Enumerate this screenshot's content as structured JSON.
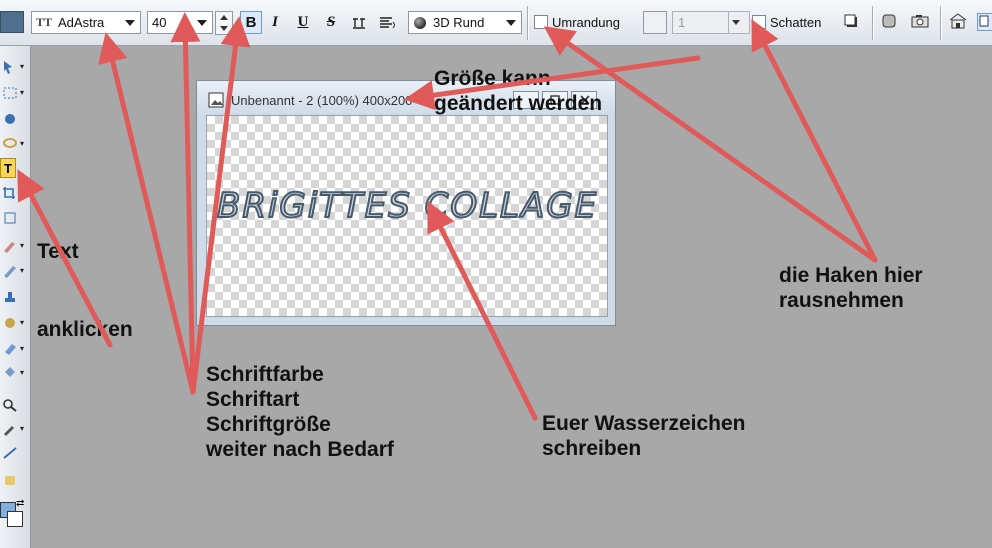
{
  "toolbar": {
    "font_name": "AdAstra",
    "font_size": "40",
    "bold_label": "B",
    "italic_label": "I",
    "underline_label": "U",
    "strike_label": "S",
    "style_name": "3D Rund",
    "outline_label": "Umrandung",
    "outline_width": "1",
    "shadow_label": "Schatten"
  },
  "canvas_window": {
    "title": "Unbenannt - 2 (100%) 400x200",
    "watermark_text": "BRiGiTTES COLLAGE"
  },
  "annotations": {
    "size_note_line1": "Größe kann",
    "size_note_line2": "geändert werden",
    "text_tool_line1": "Text",
    "text_tool_line2": "anklicken",
    "font_line1": "Schriftfarbe",
    "font_line2": "Schriftart",
    "font_line3": "Schriftgröße",
    "font_line4": "weiter nach Bedarf",
    "watermark_line1": "Euer Wasserzeichen",
    "watermark_line2": "schreiben",
    "checkbox_line1": "die Haken hier",
    "checkbox_line2": "rausnehmen"
  },
  "colors": {
    "arrow": "#e05a5a",
    "font_color": "#4f6f8f",
    "active_tool": "#f5d65a"
  }
}
